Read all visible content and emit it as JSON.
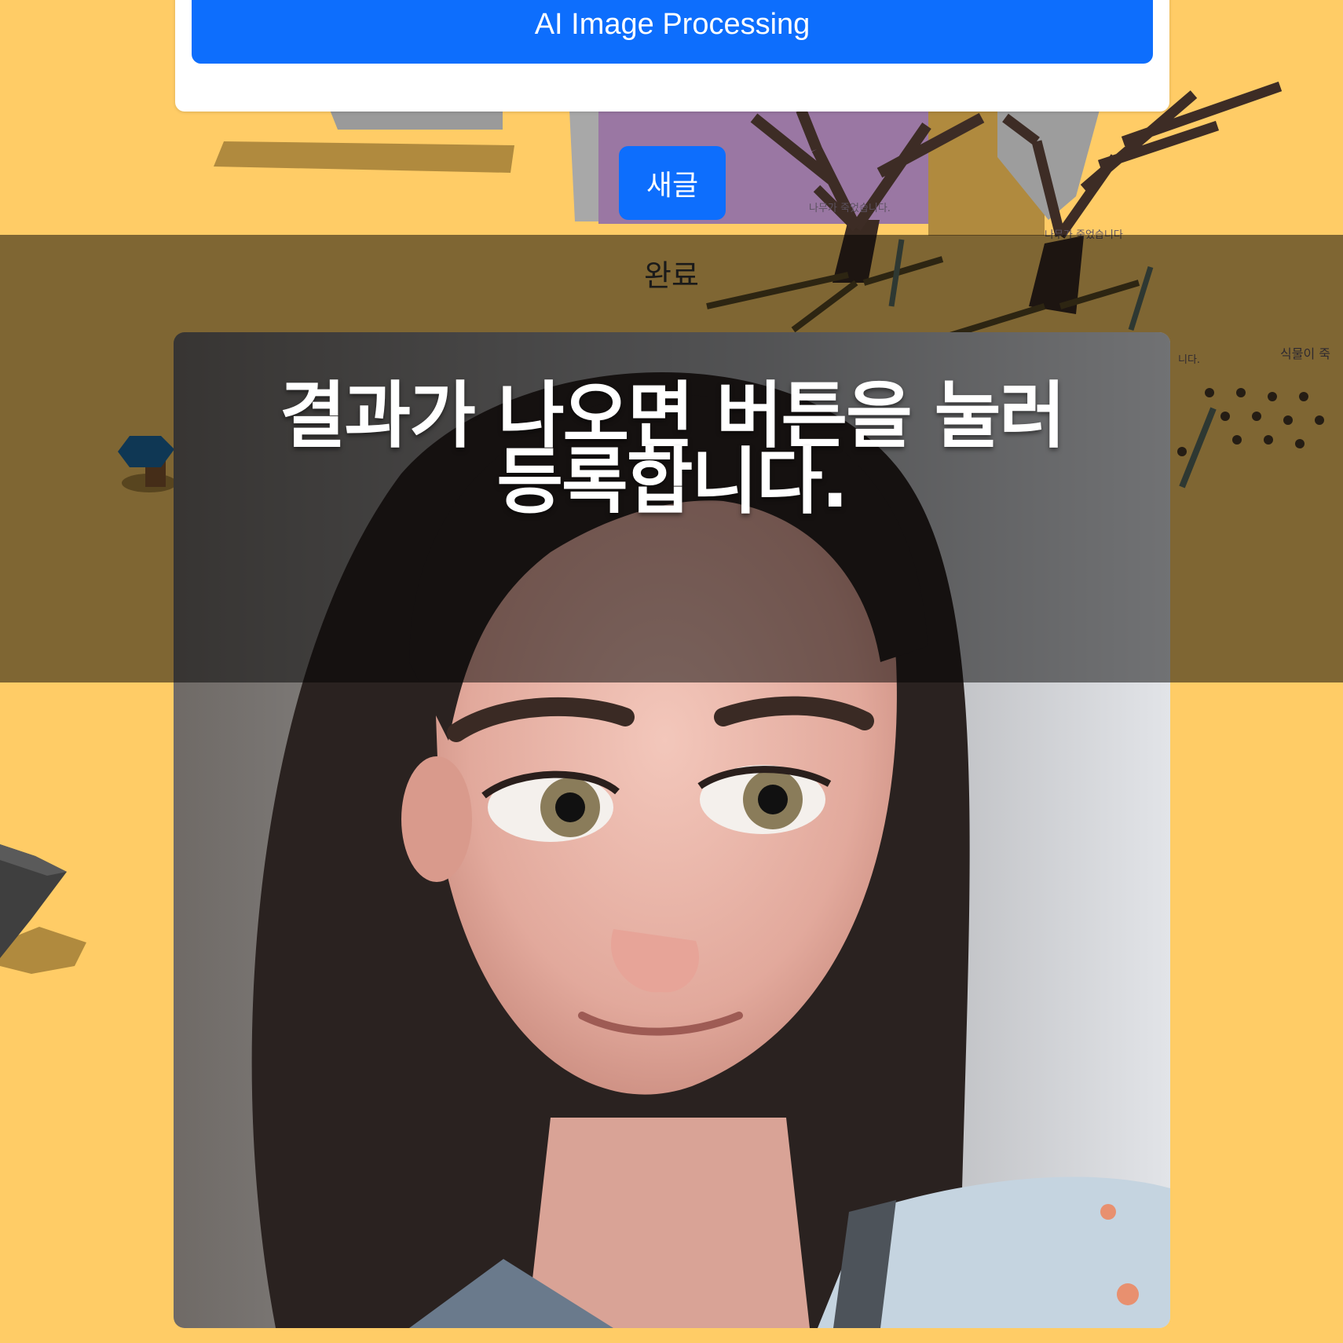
{
  "header": {
    "ai_button_label": "AI Image Processing"
  },
  "scene": {
    "new_post_label": "새글",
    "tree_label_1": "나무가 죽었습니다.",
    "tree_label_2": "나무가 죽었습니다",
    "plant_label_partial": "니다.",
    "plant_label_2": "식물이 죽"
  },
  "overlay": {
    "done_label": "완료",
    "caption_line1": "결과가 나오면 버튼을 눌러",
    "caption_line2": "등록합니다."
  },
  "colors": {
    "background": "#FFCC66",
    "primary": "#0D6EFD",
    "overlay": "rgba(0,0,0,0.5)"
  }
}
